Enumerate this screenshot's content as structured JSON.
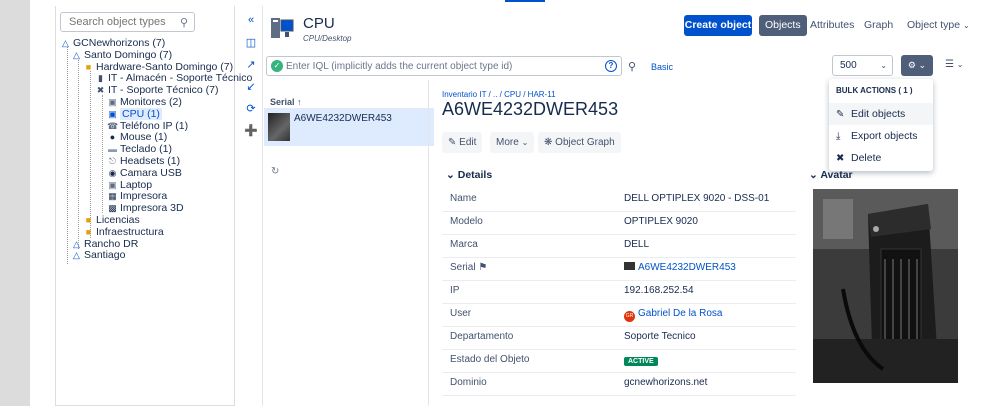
{
  "colors": {
    "primary": "#0052cc",
    "active_badge": "#00875a",
    "selected_bg": "#deebff"
  },
  "sidebar": {
    "search_placeholder": "Search object types",
    "tree": [
      {
        "label": "GCNewhorizons (7)",
        "icon": "schema-icon"
      },
      {
        "label": "Santo Domingo (7)",
        "icon": "schema-icon"
      },
      {
        "label": "Hardware-Santo Domingo (7)",
        "icon": "folder-icon"
      },
      {
        "label": "IT - Almacén - Soporte Técnico",
        "icon": "server-icon"
      },
      {
        "label": "IT - Soporte Técnico (7)",
        "icon": "tools-icon"
      },
      {
        "label": "Monitores (2)",
        "icon": "monitor-icon"
      },
      {
        "label": "CPU (1)",
        "icon": "cpu-icon"
      },
      {
        "label": "Teléfono IP (1)",
        "icon": "phone-icon"
      },
      {
        "label": "Mouse (1)",
        "icon": "mouse-icon"
      },
      {
        "label": "Teclado (1)",
        "icon": "keyboard-icon"
      },
      {
        "label": "Headsets (1)",
        "icon": "headset-icon"
      },
      {
        "label": "Camara USB",
        "icon": "camera-icon"
      },
      {
        "label": "Laptop",
        "icon": "laptop-icon"
      },
      {
        "label": "Impresora",
        "icon": "printer-icon"
      },
      {
        "label": "Impresora 3D",
        "icon": "printer3d-icon"
      },
      {
        "label": "Licencias",
        "icon": "folder-icon"
      },
      {
        "label": "Infraestructura",
        "icon": "folder-icon"
      },
      {
        "label": "Rancho DR",
        "icon": "schema-icon"
      },
      {
        "label": "Santiago",
        "icon": "schema-icon"
      }
    ]
  },
  "header": {
    "title": "CPU",
    "subtitle": "CPU/Desktop",
    "create_label": "Create object",
    "tabs": [
      "Objects",
      "Attributes",
      "Graph",
      "Object type"
    ]
  },
  "filter": {
    "iql_placeholder": "Enter IQL (implicitly adds the current object type id)",
    "basic_label": "Basic",
    "page_size": "500"
  },
  "bulk_menu": {
    "title": "BULK ACTIONS ( 1 )",
    "items": [
      "Edit objects",
      "Export objects",
      "Delete"
    ]
  },
  "list": {
    "header": "Serial",
    "rows": [
      "A6WE4232DWER453"
    ]
  },
  "object": {
    "breadcrumb": "Inventario IT / .. / CPU / HAR-11",
    "title": "A6WE4232DWER453",
    "actions": {
      "edit": "Edit",
      "more": "More",
      "graph": "Object Graph"
    },
    "details_label": "Details",
    "avatar_label": "Avatar",
    "details": [
      {
        "key": "Name",
        "value": "DELL OPTIPLEX 9020 - DSS-01"
      },
      {
        "key": "Modelo",
        "value": "OPTIPLEX 9020"
      },
      {
        "key": "Marca",
        "value": "DELL"
      },
      {
        "key": "Serial",
        "value": "A6WE4232DWER453"
      },
      {
        "key": "IP",
        "value": "192.168.252.54"
      },
      {
        "key": "User",
        "value": "Gabriel De la Rosa",
        "initials": "GR"
      },
      {
        "key": "Departamento",
        "value": "Soporte Tecnico"
      },
      {
        "key": "Estado del Objeto",
        "value": "ACTIVE"
      },
      {
        "key": "Dominio",
        "value": "gcnewhorizons.net"
      }
    ]
  }
}
